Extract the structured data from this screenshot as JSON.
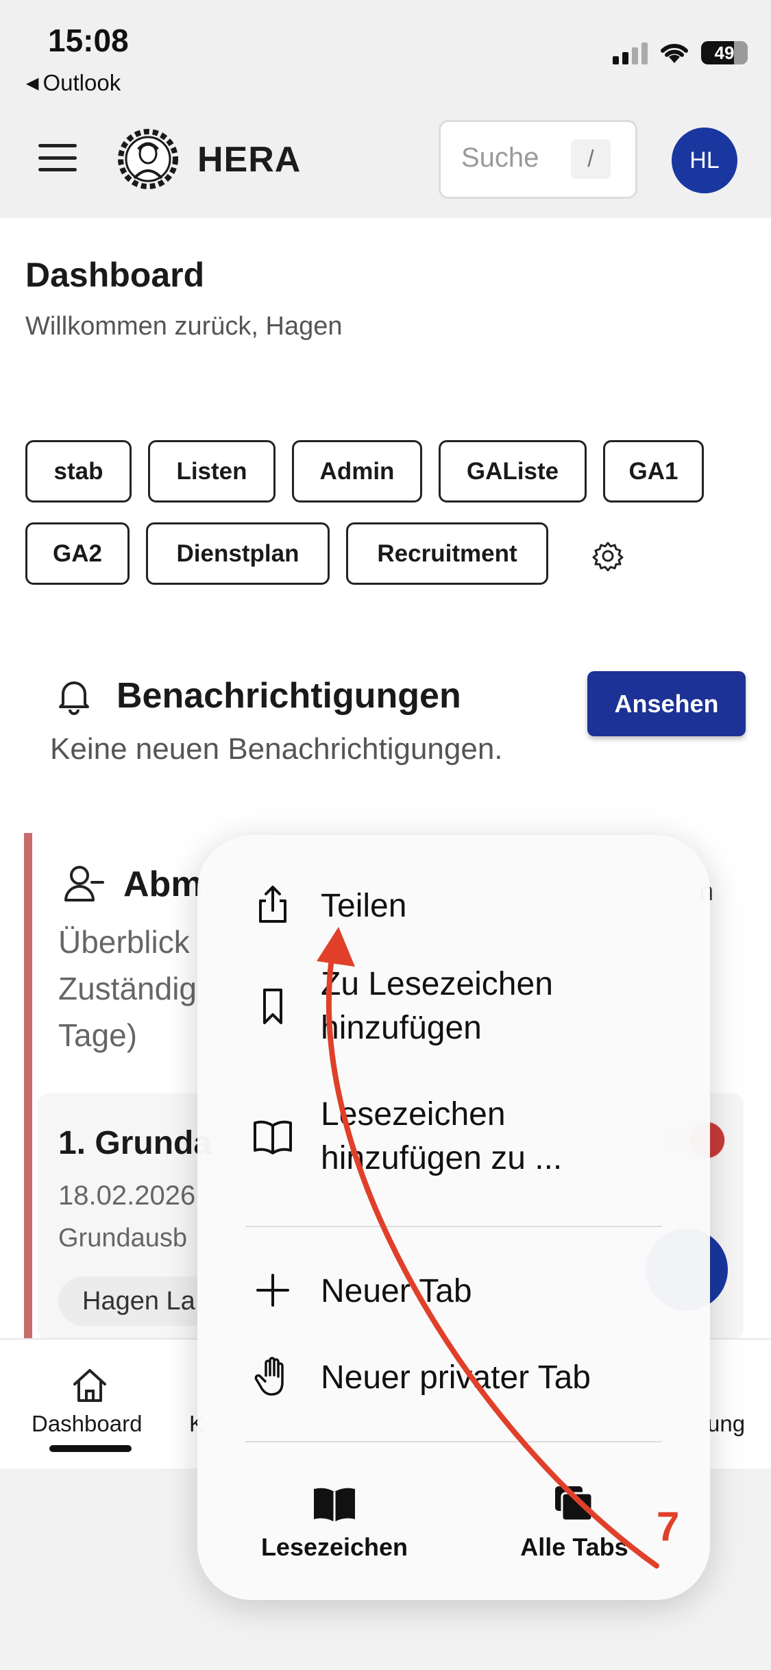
{
  "status_bar": {
    "time": "15:08",
    "back_app": "Outlook",
    "battery": "49"
  },
  "header": {
    "brand": "HERA",
    "search_placeholder": "Suche",
    "search_shortcut": "/",
    "avatar_initials": "HL"
  },
  "page": {
    "title": "Dashboard",
    "subtitle": "Willkommen zurück, Hagen"
  },
  "quick_links": [
    "stab",
    "Listen",
    "Admin",
    "GAListe",
    "GA1",
    "GA2",
    "Dienstplan",
    "Recruitment"
  ],
  "notifications": {
    "title": "Benachrichtigungen",
    "text": "Keine neuen Benachrichtigungen.",
    "button": "Ansehen"
  },
  "absence_card": {
    "title": "Abm",
    "text": "Überblick\nZuständig\nTage)",
    "entry_title": "1. Grunda",
    "entry_date": "18.02.2026",
    "entry_sub": "Grundausb",
    "entry_person": "Hagen La",
    "behind_text": "n"
  },
  "bottom_nav": {
    "home": "Dashboard",
    "second_partial": "K",
    "last_partial": "ung"
  },
  "context_menu": {
    "items": [
      {
        "label": "Teilen",
        "icon": "share-icon"
      },
      {
        "label": "Zu Lesezeichen\nhinzufügen",
        "icon": "bookmark-icon"
      },
      {
        "label": "Lesezeichen\nhinzufügen zu ...",
        "icon": "book-icon"
      },
      {
        "label": "Neuer Tab",
        "icon": "plus-icon"
      },
      {
        "label": "Neuer privater Tab",
        "icon": "hand-icon"
      }
    ],
    "bottom": [
      {
        "label": "Lesezeichen",
        "icon": "book-filled-icon"
      },
      {
        "label": "Alle Tabs",
        "icon": "tabs-icon"
      }
    ]
  },
  "annotation": {
    "step_number": "7",
    "color": "#e0402a"
  }
}
